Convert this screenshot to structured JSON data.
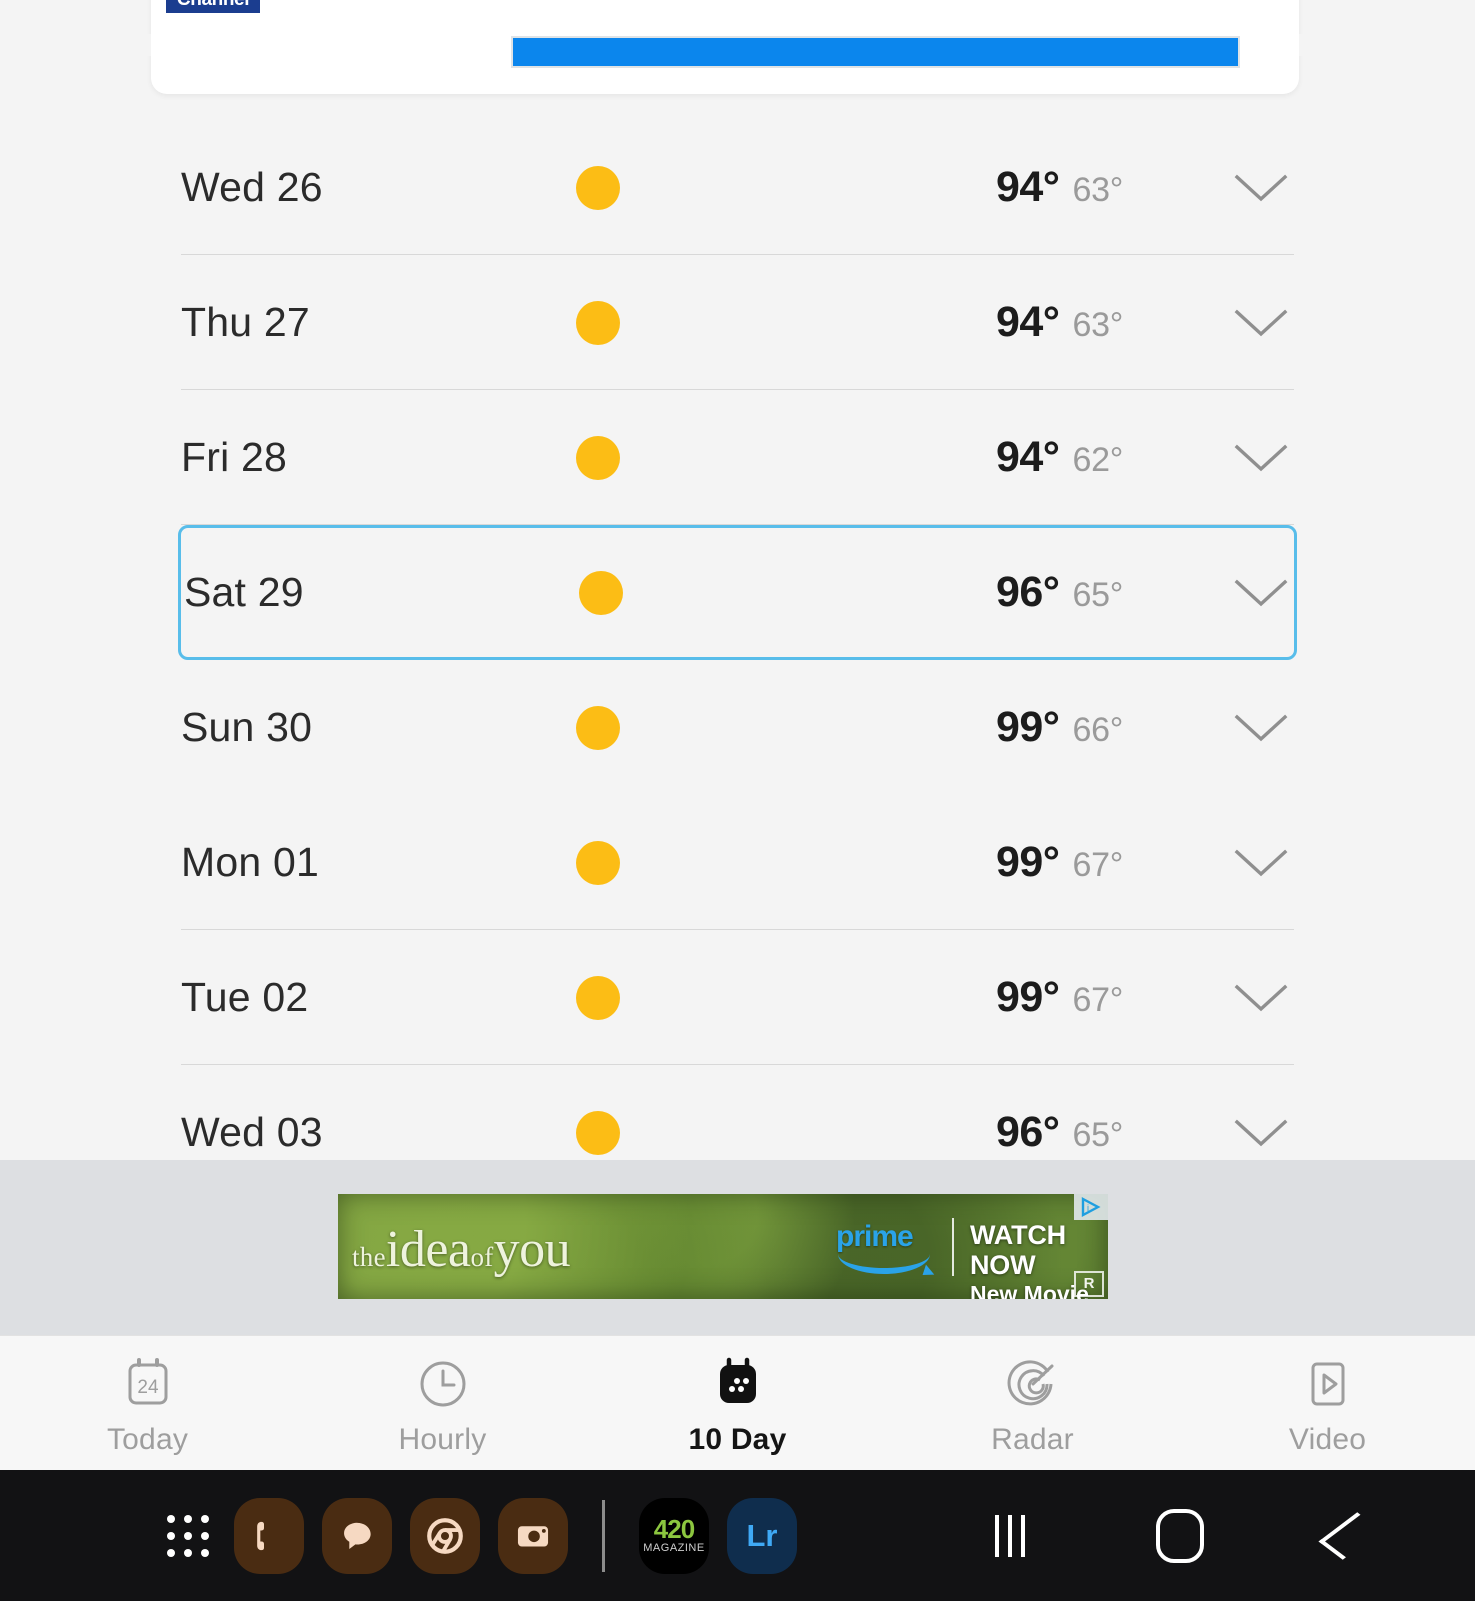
{
  "app": {
    "brand_badge": "Channel",
    "accent_blue": "#0b86ed",
    "selection_blue": "#58bdea",
    "sun_yellow": "#fcbd15"
  },
  "forecast": {
    "days": [
      {
        "day": "Wed 26",
        "icon": "sunny-icon",
        "high": "94°",
        "low": "63°",
        "selected": false
      },
      {
        "day": "Thu 27",
        "icon": "sunny-icon",
        "high": "94°",
        "low": "63°",
        "selected": false
      },
      {
        "day": "Fri 28",
        "icon": "sunny-icon",
        "high": "94°",
        "low": "62°",
        "selected": false
      },
      {
        "day": "Sat 29",
        "icon": "sunny-icon",
        "high": "96°",
        "low": "65°",
        "selected": true
      },
      {
        "day": "Sun 30",
        "icon": "sunny-icon",
        "high": "99°",
        "low": "66°",
        "selected": false
      },
      {
        "day": "Mon 01",
        "icon": "sunny-icon",
        "high": "99°",
        "low": "67°",
        "selected": false
      },
      {
        "day": "Tue 02",
        "icon": "sunny-icon",
        "high": "99°",
        "low": "67°",
        "selected": false
      },
      {
        "day": "Wed 03",
        "icon": "sunny-icon",
        "high": "96°",
        "low": "65°",
        "selected": false
      }
    ]
  },
  "ad": {
    "title_the": "the",
    "title_idea": "idea",
    "title_of": "of",
    "title_you": "you",
    "brand": "prime",
    "cta_main": "WATCH NOW",
    "cta_sub": "New Movie",
    "rating": "R",
    "adchoices_label": "i"
  },
  "tabs": [
    {
      "label": "Today",
      "icon": "calendar-24-icon",
      "active": false
    },
    {
      "label": "Hourly",
      "icon": "clock-icon",
      "active": false
    },
    {
      "label": "10 Day",
      "icon": "calendar-dots-icon",
      "active": true
    },
    {
      "label": "Radar",
      "icon": "radar-icon",
      "active": false
    },
    {
      "label": "Video",
      "icon": "video-play-icon",
      "active": false
    }
  ],
  "taskbar": {
    "apps": [
      {
        "name": "app-drawer",
        "label": ""
      },
      {
        "name": "phone",
        "label": ""
      },
      {
        "name": "messages",
        "label": ""
      },
      {
        "name": "chrome",
        "label": ""
      },
      {
        "name": "camera",
        "label": ""
      }
    ],
    "mag_top": "420",
    "mag_bottom": "MAGAZINE",
    "lightroom": "Lr"
  }
}
